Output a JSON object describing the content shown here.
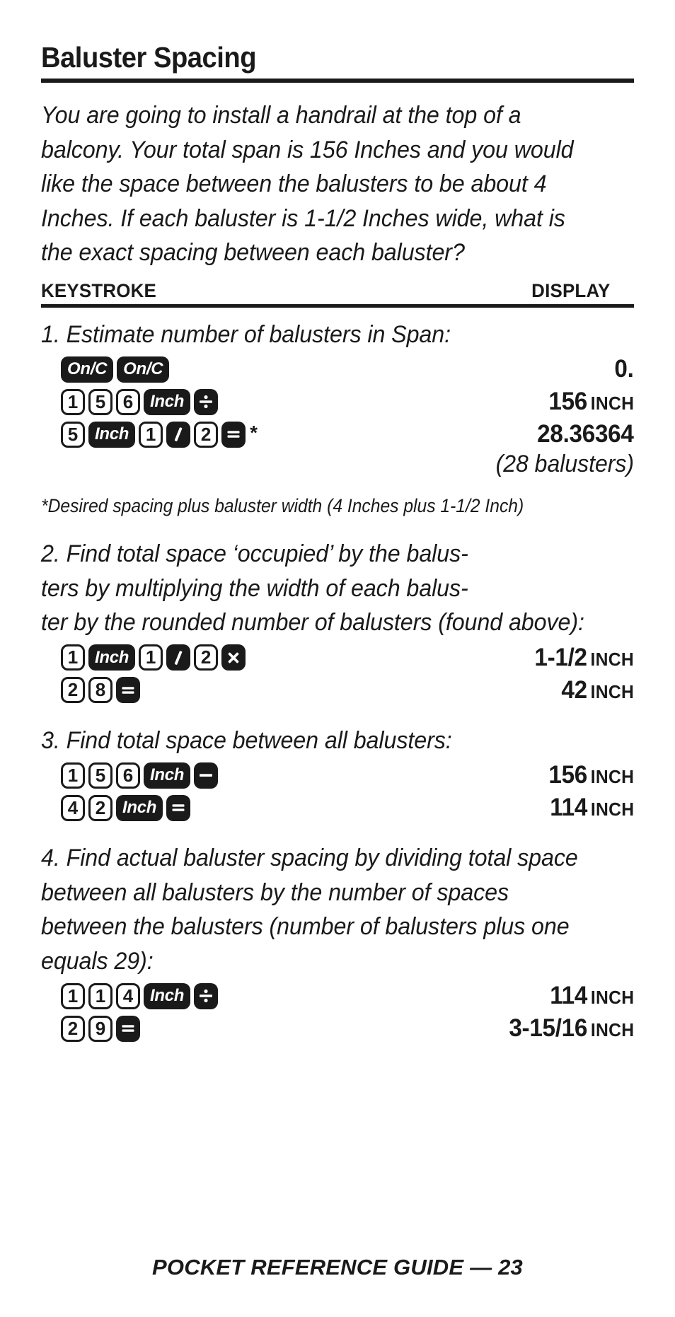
{
  "title": "Baluster Spacing",
  "intro": "You are going to install a handrail at the top of a balcony. Your total span is 156 Inches and you would like the space between the balusters to be about 4 Inches. If each baluster is 1-1/2 Inches wide, what is the exact spacing between each baluster?",
  "columns": {
    "keystroke": "KEYSTROKE",
    "display": "DISPLAY"
  },
  "steps": [
    {
      "text": "1. Estimate number of balusters in Span:",
      "rows": [
        {
          "keys": [
            {
              "type": "fn",
              "style": "onc",
              "label": "On/C"
            },
            {
              "type": "fn",
              "style": "onc",
              "label": "On/C"
            }
          ],
          "display": "0.",
          "unit": ""
        },
        {
          "keys": [
            {
              "type": "num",
              "label": "1"
            },
            {
              "type": "num",
              "label": "5"
            },
            {
              "type": "num",
              "label": "6"
            },
            {
              "type": "fn",
              "style": "word",
              "label": "Inch"
            },
            {
              "type": "fn",
              "style": "op",
              "label": "divide",
              "icon": "divide-icon"
            }
          ],
          "display": "156",
          "unit": "INCH"
        },
        {
          "keys": [
            {
              "type": "num",
              "label": "5"
            },
            {
              "type": "fn",
              "style": "word",
              "label": "Inch"
            },
            {
              "type": "num",
              "label": "1"
            },
            {
              "type": "fn",
              "style": "op",
              "label": "/",
              "icon": "slash-icon"
            },
            {
              "type": "num",
              "label": "2"
            },
            {
              "type": "fn",
              "style": "op",
              "label": "equals",
              "icon": "equals-icon"
            }
          ],
          "suffix": "*",
          "display": "28.36364",
          "unit": ""
        }
      ],
      "note": "(28 balusters)",
      "footnote": "*Desired spacing plus baluster width (4 Inches plus 1-1/2 Inch)"
    },
    {
      "text": "2. Find total space ‘occupied’ by the balus-ters by multiplying the width of each balus-ter by the rounded number of balusters (found above):",
      "rows": [
        {
          "keys": [
            {
              "type": "num",
              "label": "1"
            },
            {
              "type": "fn",
              "style": "word",
              "label": "Inch"
            },
            {
              "type": "num",
              "label": "1"
            },
            {
              "type": "fn",
              "style": "op",
              "label": "/",
              "icon": "slash-icon"
            },
            {
              "type": "num",
              "label": "2"
            },
            {
              "type": "fn",
              "style": "op",
              "label": "multiply",
              "icon": "multiply-icon"
            }
          ],
          "display": "1-1/2",
          "unit": "INCH"
        },
        {
          "keys": [
            {
              "type": "num",
              "label": "2"
            },
            {
              "type": "num",
              "label": "8"
            },
            {
              "type": "fn",
              "style": "op",
              "label": "equals",
              "icon": "equals-icon"
            }
          ],
          "display": "42",
          "unit": "INCH"
        }
      ]
    },
    {
      "text": "3. Find total space between all balusters:",
      "rows": [
        {
          "keys": [
            {
              "type": "num",
              "label": "1"
            },
            {
              "type": "num",
              "label": "5"
            },
            {
              "type": "num",
              "label": "6"
            },
            {
              "type": "fn",
              "style": "word",
              "label": "Inch"
            },
            {
              "type": "fn",
              "style": "op",
              "label": "minus",
              "icon": "minus-icon"
            }
          ],
          "display": "156",
          "unit": "INCH"
        },
        {
          "keys": [
            {
              "type": "num",
              "label": "4"
            },
            {
              "type": "num",
              "label": "2"
            },
            {
              "type": "fn",
              "style": "word",
              "label": "Inch"
            },
            {
              "type": "fn",
              "style": "op",
              "label": "equals",
              "icon": "equals-icon"
            }
          ],
          "display": "114",
          "unit": "INCH"
        }
      ]
    },
    {
      "text": "4. Find actual baluster spacing by dividing total space between all balusters by the number of spaces between the balusters (number of balusters plus one equals 29):",
      "rows": [
        {
          "keys": [
            {
              "type": "num",
              "label": "1"
            },
            {
              "type": "num",
              "label": "1"
            },
            {
              "type": "num",
              "label": "4"
            },
            {
              "type": "fn",
              "style": "word",
              "label": "Inch"
            },
            {
              "type": "fn",
              "style": "op",
              "label": "divide",
              "icon": "divide-icon"
            }
          ],
          "display": "114",
          "unit": "INCH"
        },
        {
          "keys": [
            {
              "type": "num",
              "label": "2"
            },
            {
              "type": "num",
              "label": "9"
            },
            {
              "type": "fn",
              "style": "op",
              "label": "equals",
              "icon": "equals-icon"
            }
          ],
          "display": "3-15/16",
          "unit": "INCH"
        }
      ]
    }
  ],
  "footer": {
    "text": "Pocket Reference Guide — 23",
    "page_number": "23"
  }
}
